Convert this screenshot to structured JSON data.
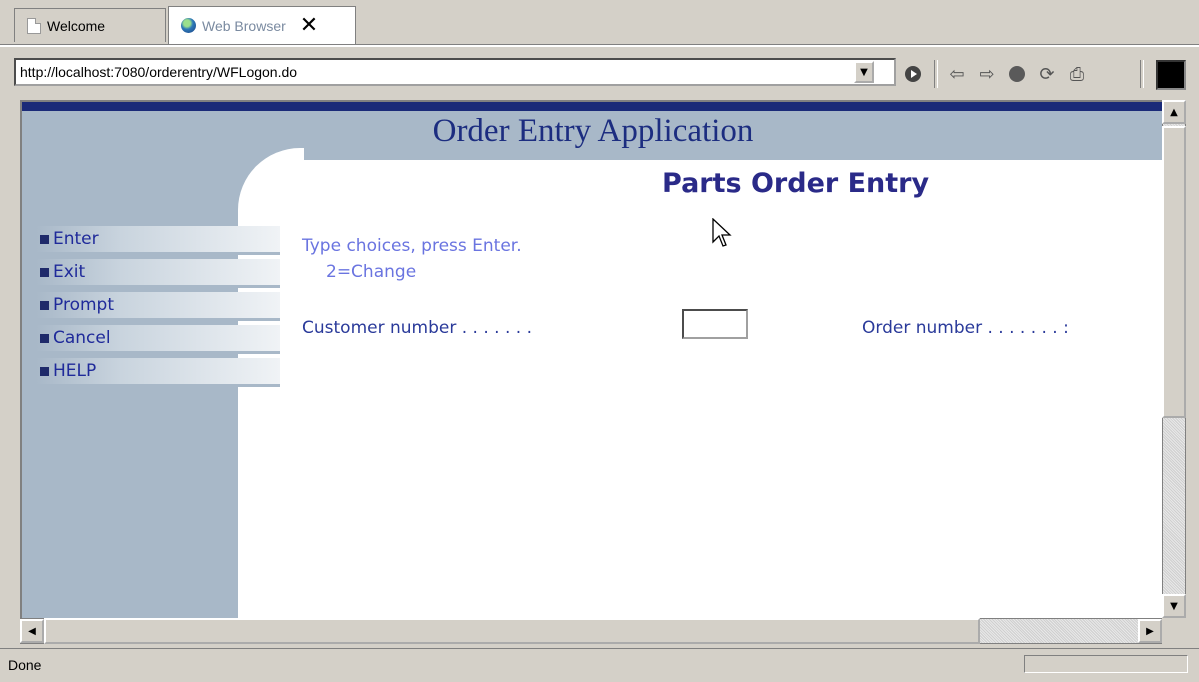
{
  "tabs": [
    {
      "label": "Welcome"
    },
    {
      "label": "Web Browser"
    }
  ],
  "toolbar": {
    "url": "http://localhost:7080/orderentry/WFLogon.do"
  },
  "page": {
    "app_title": "Order Entry Application",
    "heading": "Parts Order Entry",
    "instructions": {
      "line1": "Type choices, press Enter.",
      "line2": "2=Change"
    },
    "customer_label": "Customer number . . . . . . .",
    "order_label": "Order number  . . . . . . . :",
    "nav_items": [
      "Enter",
      "Exit",
      "Prompt",
      "Cancel",
      "HELP"
    ]
  },
  "status": {
    "text": "Done"
  },
  "colors": {
    "header_band": "#a8b8c8",
    "title_blue": "#1c2d80",
    "nav_text": "#1f2a9a"
  }
}
